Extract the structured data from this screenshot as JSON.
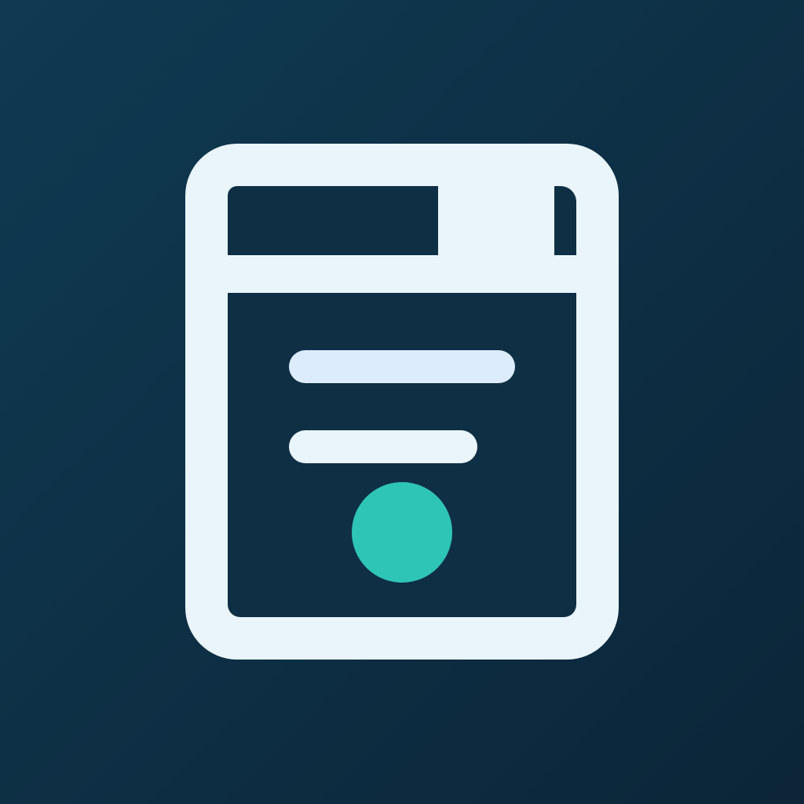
{
  "icon": {
    "name": "save-document-icon",
    "colors": {
      "background_start": "#0f3a52",
      "background_end": "#0c2538",
      "outline": "#eaf5fb",
      "inner": "#0f2f45",
      "line_primary": "#dcecfc",
      "line_secondary": "#eaf5fb",
      "dot": "#2ec5b6"
    }
  }
}
